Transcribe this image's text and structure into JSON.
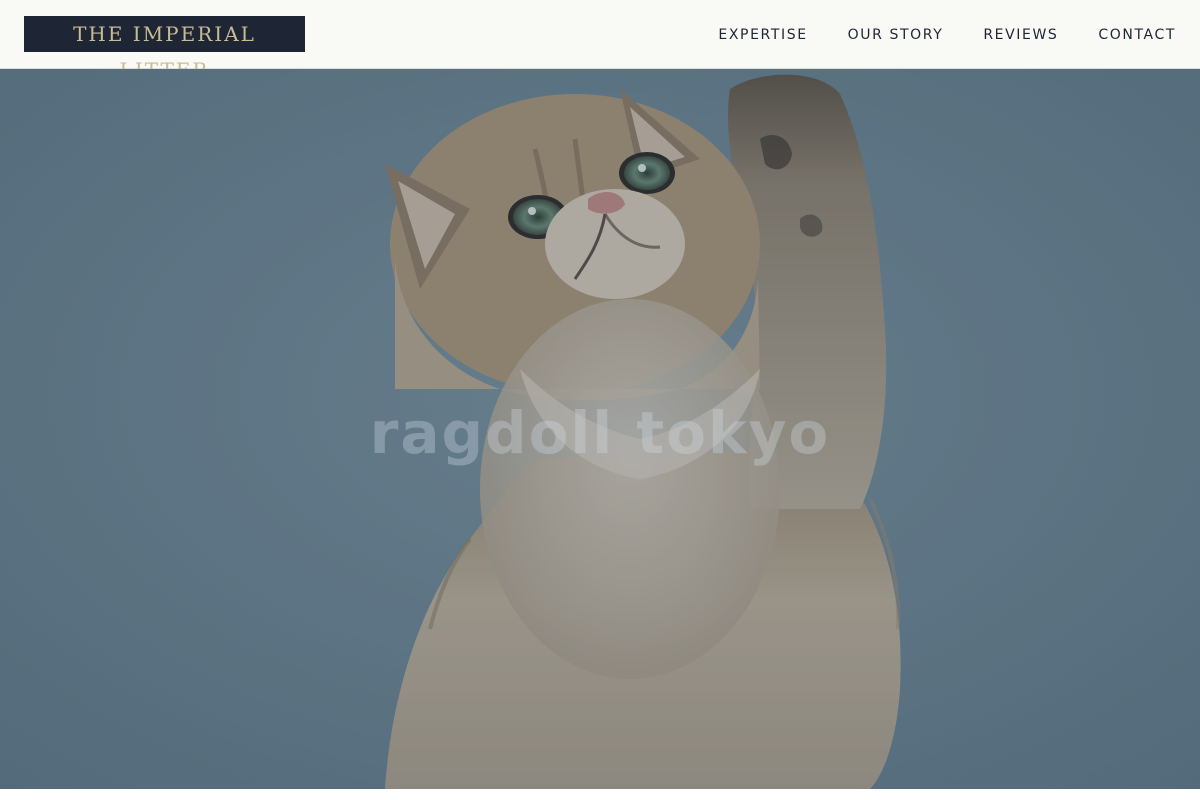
{
  "brand": {
    "name": "THE IMPERIAL LITTER"
  },
  "nav": {
    "items": [
      {
        "label": "EXPERTISE"
      },
      {
        "label": "OUR STORY"
      },
      {
        "label": "REVIEWS"
      },
      {
        "label": "CONTACT"
      }
    ]
  },
  "hero": {
    "title": "ragdoll tokyo",
    "image": "kitten-reaching-up-photo"
  },
  "colors": {
    "header_bg": "#f9f9f6",
    "logo_bg": "#1e2636",
    "logo_text": "#c8bb95",
    "nav_text": "#1e2636",
    "hero_bg": "#6c8593"
  }
}
